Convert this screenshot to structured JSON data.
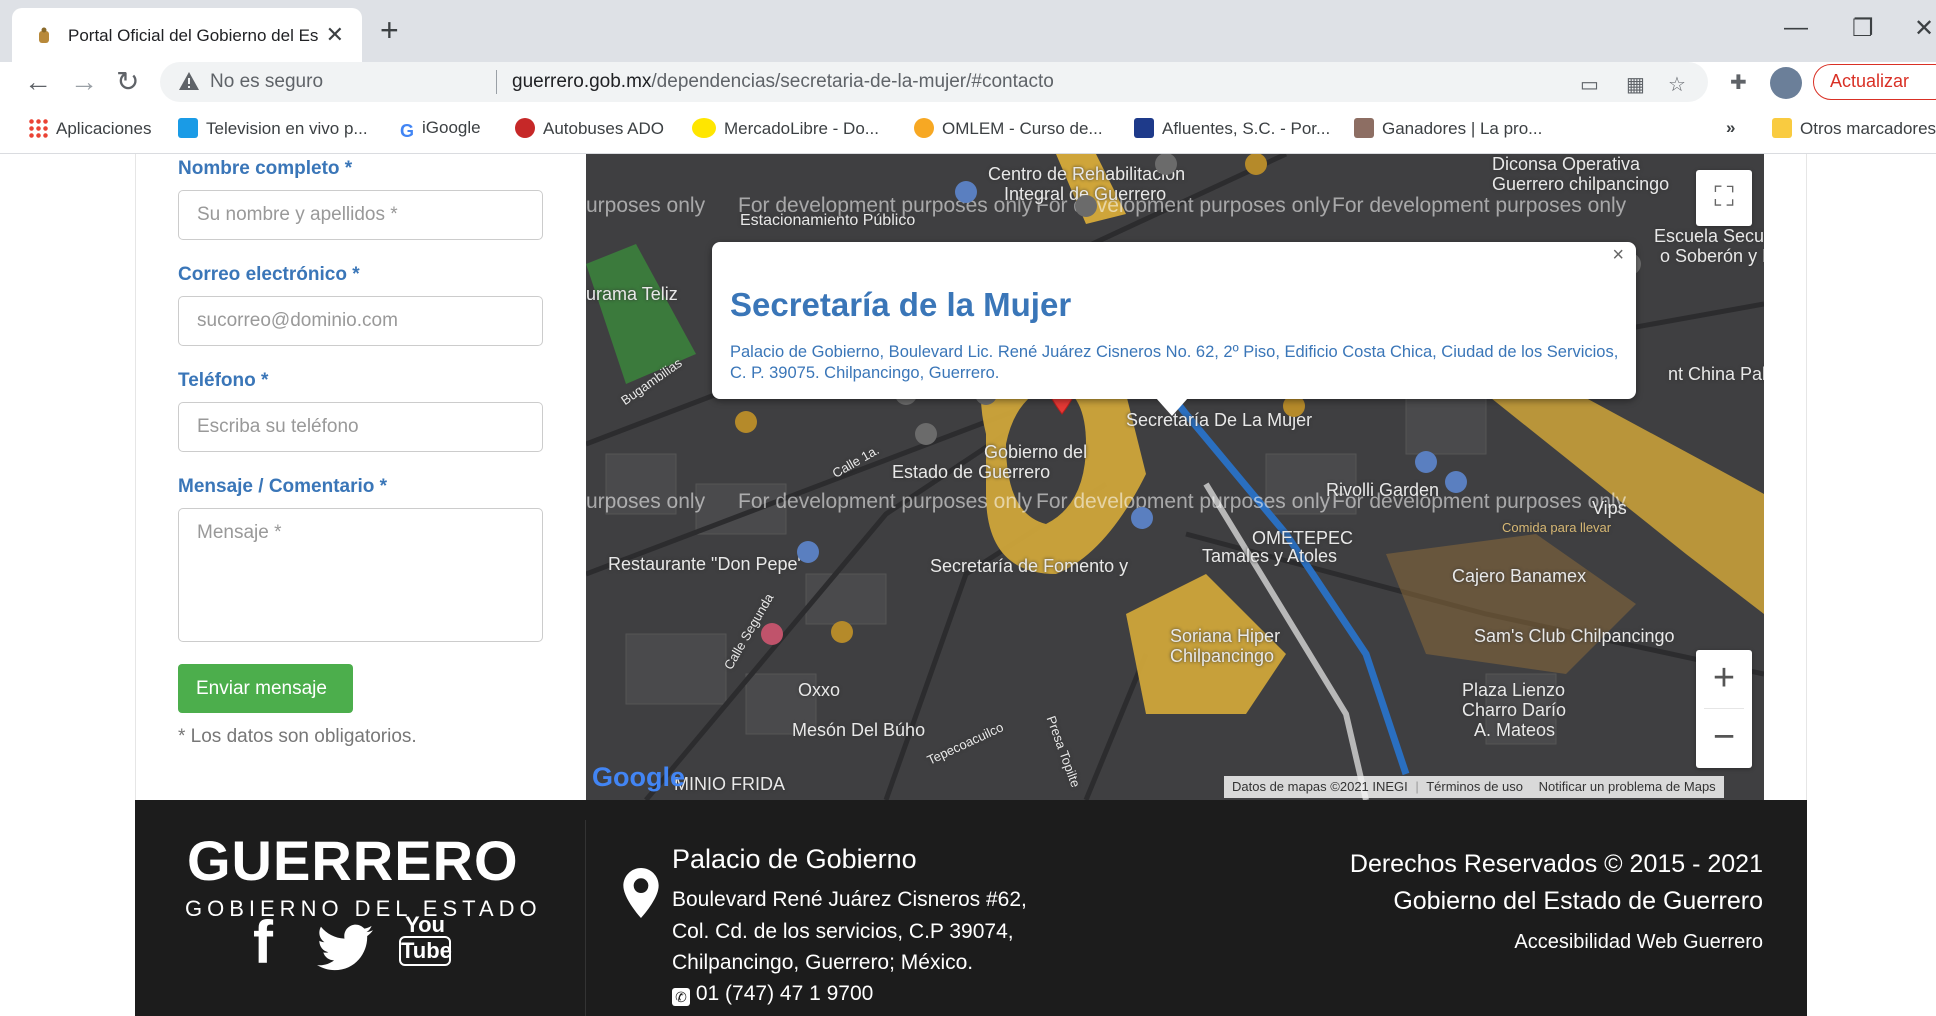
{
  "browser": {
    "tab_title": "Portal Oficial del Gobierno del Es",
    "security_label": "No es seguro",
    "url_domain": "guerrero.gob.mx",
    "url_path": "/dependencias/secretaria-de-la-mujer/#contacto",
    "update_label": "Actualizar",
    "bookmarks": [
      {
        "label": "Aplicaciones",
        "color": "#ea4335"
      },
      {
        "label": "Television en vivo p...",
        "color": "#1a9be6"
      },
      {
        "label": "iGoogle",
        "color": "#4285f4"
      },
      {
        "label": "Autobuses ADO",
        "color": "#c62828"
      },
      {
        "label": "MercadoLibre - Do...",
        "color": "#ffe600"
      },
      {
        "label": "OMLEM - Curso de...",
        "color": "#f7a823"
      },
      {
        "label": "Afluentes, S.C. - Por...",
        "color": "#1e3a8a"
      },
      {
        "label": "Ganadores | La pro...",
        "color": "#8d6e63"
      }
    ],
    "bookmarks_more": "»",
    "other_bookmarks": "Otros marcadores"
  },
  "form": {
    "name_label": "Nombre completo *",
    "name_placeholder": "Su nombre y apellidos *",
    "email_label": "Correo electrónico *",
    "email_placeholder": "sucorreo@dominio.com",
    "phone_label": "Teléfono *",
    "phone_placeholder": "Escriba su teléfono",
    "message_label": "Mensaje / Comentario *",
    "message_placeholder": "Mensaje *",
    "submit_label": "Enviar mensaje",
    "required_note": "* Los datos son obligatorios."
  },
  "map": {
    "dev_watermark": "For development purposes only",
    "dev_watermark_partial": "urposes only",
    "popup_title": "Secretaría de la Mujer",
    "popup_address": "Palacio de Gobierno, Boulevard Lic. René Juárez Cisneros No. 62, 2º Piso, Edificio Costa Chica, Ciudad de los Servicios, C. P. 39075. Chilpancingo, Guerrero.",
    "popup_close": "×",
    "zoom_in": "+",
    "zoom_out": "−",
    "attribution_data": "Datos de mapas ©2021 INEGI",
    "attribution_terms": "Términos de uso",
    "attribution_report": "Notificar un problema de Maps",
    "google_logo": "Google",
    "places": [
      "Centro de Rehabilitación",
      "Integral de Guerrero",
      "Estacionamiento Público",
      "Diconsa Operativa",
      "Guerrero chilpancingo",
      "Escuela Secund",
      "o Soberón y Pa",
      "urama Teliz",
      "Bugambilias",
      "nt China Palac",
      "Secretaría De La Mujer",
      "Gobierno del",
      "Estado de Guerrero",
      "Calle 1a.",
      "Rivolli Garden",
      "OMETEPEC",
      "Tamales y Atoles",
      "Vips",
      "Comida para llevar",
      "Restaurante \"Don Pepe\"",
      "Secretaría de Fomento y",
      "Cajero Banamex",
      "Soriana Hiper",
      "Chilpancingo",
      "Sam's Club Chilpancingo",
      "Oxxo",
      "Mesón Del Búho",
      "Plaza Lienzo",
      "Charro Darío",
      "A. Mateos",
      "MINIO FRIDA",
      "Calle Segunda",
      "Tepecoacuilco",
      "Presa Topilte"
    ]
  },
  "footer": {
    "brand": "GUERRERO",
    "brand_sub": "GOBIERNO DEL ESTADO",
    "address_title": "Palacio de Gobierno",
    "address_lines": [
      "Boulevard René Juárez Cisneros #62,",
      "Col. Cd. de los servicios, C.P 39074,",
      "Chilpancingo, Guerrero; México."
    ],
    "phone": "01 (747) 47 1 9700",
    "rights_line1": "Derechos Reservados © 2015 - 2021",
    "rights_line2": "Gobierno del Estado de Guerrero",
    "accessibility": "Accesibilidad Web Guerrero",
    "youtube_you": "You",
    "youtube_tube": "Tube"
  }
}
